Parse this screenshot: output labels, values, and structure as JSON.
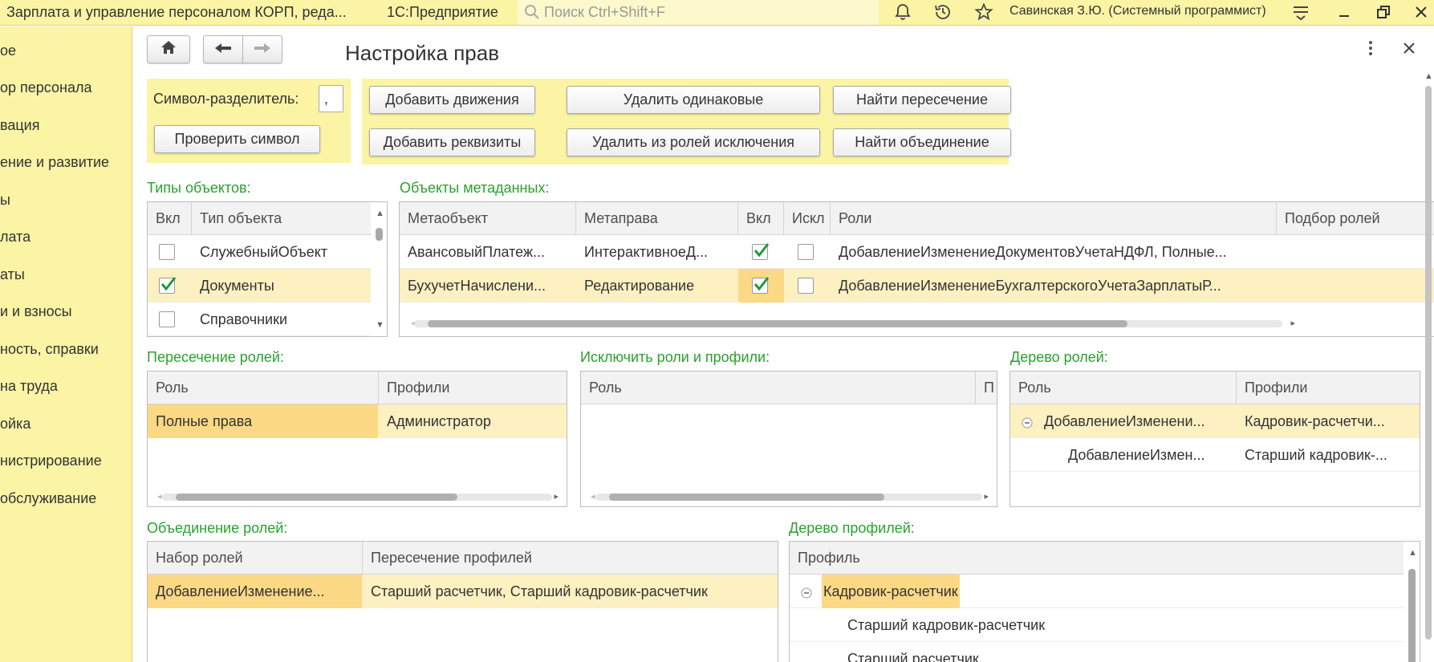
{
  "window": {
    "app_title": "Зарплата и управление персоналом КОРП, реда...",
    "platform": "1С:Предприятие",
    "search_placeholder": "Поиск Ctrl+Shift+F",
    "user": "Савинская З.Ю. (Системный программист)"
  },
  "sidebar": {
    "items": [
      {
        "label": "ое"
      },
      {
        "label": "ор персонала"
      },
      {
        "label": "вация"
      },
      {
        "label": "ение и развитие"
      },
      {
        "label": "ы"
      },
      {
        "label": "лата"
      },
      {
        "label": "аты"
      },
      {
        "label": "и и взносы"
      },
      {
        "label": "ность, справки"
      },
      {
        "label": "на труда"
      },
      {
        "label": "ойка"
      },
      {
        "label": "нистрирование"
      },
      {
        "label": "обслуживание"
      }
    ]
  },
  "page": {
    "title": "Настройка прав"
  },
  "separator": {
    "label": "Символ-разделитель:",
    "value": ",",
    "check_button": "Проверить символ"
  },
  "actions": {
    "add_movements": "Добавить движения",
    "delete_same": "Удалить одинаковые",
    "find_intersection": "Найти пересечение",
    "add_requisites": "Добавить реквизиты",
    "delete_exceptions": "Удалить из ролей исключения",
    "find_union": "Найти объединение"
  },
  "object_types": {
    "label": "Типы объектов:",
    "columns": [
      "Вкл",
      "Тип объекта"
    ],
    "rows": [
      {
        "checked": false,
        "name": "СлужебныйОбъект"
      },
      {
        "checked": true,
        "name": "Документы"
      },
      {
        "checked": false,
        "name": "Справочники"
      }
    ]
  },
  "metadata_objects": {
    "label": "Объекты метаданных:",
    "columns": [
      "Метаобъект",
      "Метаправа",
      "Вкл",
      "Искл",
      "Роли",
      "Подбор ролей"
    ],
    "rows": [
      {
        "object": "АвансовыйПлатеж...",
        "right": "ИнтерактивноеД...",
        "on": true,
        "excl": false,
        "roles": "ДобавлениеИзменениеДокументовУчетаНДФЛ, Полные..."
      },
      {
        "object": "БухучетНачислени...",
        "right": "Редактирование",
        "on": true,
        "excl": false,
        "roles": "ДобавлениеИзменениеБухгалтерскогоУчетаЗарплатыР..."
      }
    ]
  },
  "roles_intersection": {
    "label": "Пересечение ролей:",
    "columns": [
      "Роль",
      "Профили"
    ],
    "rows": [
      {
        "role": "Полные права",
        "profiles": "Администратор"
      }
    ]
  },
  "exclude_roles": {
    "label": "Исключить роли и профили:",
    "columns": [
      "Роль",
      "П"
    ]
  },
  "roles_tree": {
    "label": "Дерево ролей:",
    "columns": [
      "Роль",
      "Профили"
    ],
    "rows": [
      {
        "role": "ДобавлениеИзменени...",
        "profiles": "Кадровик-расчетчи..."
      },
      {
        "role": "ДобавлениеИзмен...",
        "profiles": "Старший кадровик-..."
      }
    ]
  },
  "roles_union": {
    "label": "Объединение ролей:",
    "columns": [
      "Набор ролей",
      "Пересечение профилей"
    ],
    "rows": [
      {
        "set": "ДобавлениеИзменение...",
        "profiles": "Старший расчетчик, Старший кадровик-расчетчик"
      }
    ]
  },
  "profiles_tree": {
    "label": "Дерево профилей:",
    "columns": [
      "Профиль"
    ],
    "rows": [
      {
        "name": "Кадровик-расчетчик"
      },
      {
        "name": "Старший кадровик-расчетчик"
      },
      {
        "name": "Старший расчетчик"
      }
    ]
  },
  "colors": {
    "accent_yellow": "#fbf4a5",
    "group_label_green": "#29a22d",
    "selected_row": "#fdf0c1",
    "current_cell": "#fbd985",
    "check_green": "#1e9a3a"
  }
}
